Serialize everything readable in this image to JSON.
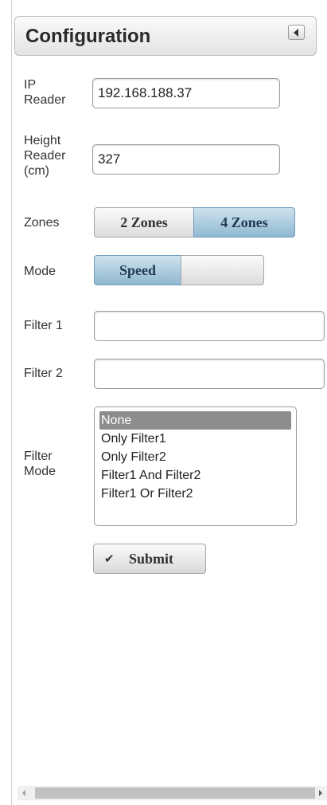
{
  "header": {
    "title": "Configuration"
  },
  "ip_reader": {
    "label_line1": "IP",
    "label_line2": "Reader",
    "value": "192.168.188.37"
  },
  "height_reader": {
    "label_line1": "Height",
    "label_line2": "Reader",
    "label_line3": "(cm)",
    "value": "327"
  },
  "zones": {
    "label": "Zones",
    "options": [
      "2 Zones",
      "4 Zones"
    ],
    "selected": "4 Zones"
  },
  "mode": {
    "label": "Mode",
    "options": [
      "Speed",
      ""
    ],
    "selected": "Speed"
  },
  "filter1": {
    "label": "Filter 1",
    "value": ""
  },
  "filter2": {
    "label": "Filter 2",
    "value": ""
  },
  "filter_mode": {
    "label_line1": "Filter",
    "label_line2": "Mode",
    "options": [
      "None",
      "Only Filter1",
      "Only Filter2",
      "Filter1 And Filter2",
      "Filter1 Or Filter2"
    ],
    "selected": "None"
  },
  "submit": {
    "label": "Submit"
  },
  "icons": {
    "collapse": "triangle-left-icon",
    "submit": "checkmark-icon"
  },
  "colors": {
    "accent": "#8fb8d2",
    "selected_option": "#8d8d8d"
  }
}
